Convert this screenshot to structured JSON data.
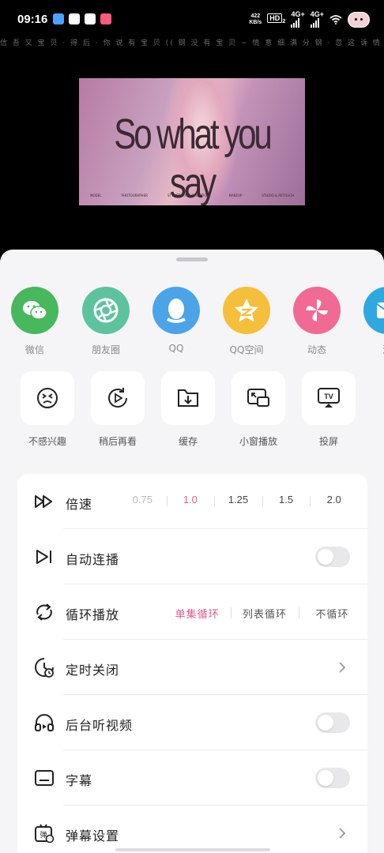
{
  "status_bar": {
    "time": "09:16",
    "net_speed_value": "422",
    "net_speed_unit": "KB/s",
    "hd_badge": "HD",
    "hd_sub": "2",
    "sim1": "4G+",
    "sim2": "4G+"
  },
  "danmaku": {
    "text": "信 吾 又 宝 贝 · 得 后 · 你 说 有 宝 贝 (( 钢 没 有 宝 贝 ~ 情 意 细 满 分 钢 · 忽 这 诉 情 意 福 · 再 是 哥 哥 · 信 吾 又 宝 贝 (( 钢"
  },
  "video": {
    "title": "So what you say",
    "credits": [
      "MODEL",
      "PHOTOGRAPHER",
      "STYLIST & ART DIRECTION",
      "MAKEUP",
      "STUDIO & RETOUCH"
    ]
  },
  "share_targets": [
    {
      "label": "微信",
      "icon": "wechat-icon",
      "color": "#47b85b"
    },
    {
      "label": "朋友圈",
      "icon": "moments-icon",
      "color": "#5cc39e"
    },
    {
      "label": "QQ",
      "icon": "qq-icon",
      "color": "#4ca4e8"
    },
    {
      "label": "QQ空间",
      "icon": "qzone-icon",
      "color": "#f5bf3b"
    },
    {
      "label": "动态",
      "icon": "pinwheel-icon",
      "color": "#f06a93"
    },
    {
      "label": "消",
      "icon": "message-icon",
      "color": "#2fa8e0"
    }
  ],
  "actions": [
    {
      "label": "不感兴趣",
      "icon": "dislike-face-icon"
    },
    {
      "label": "稍后再看",
      "icon": "watch-later-icon"
    },
    {
      "label": "缓存",
      "icon": "download-folder-icon"
    },
    {
      "label": "小窗播放",
      "icon": "picture-in-picture-icon"
    },
    {
      "label": "投屏",
      "icon": "cast-tv-icon"
    }
  ],
  "settings": {
    "speed_label": "倍速",
    "speed_options": [
      "0.75",
      "1.0",
      "1.25",
      "1.5",
      "2.0"
    ],
    "speed_selected": "1.0",
    "autoplay_label": "自动连播",
    "autoplay_on": false,
    "loop_label": "循环播放",
    "loop_options": [
      "单集循环",
      "列表循环",
      "不循环"
    ],
    "loop_selected": "单集循环",
    "timer_label": "定时关闭",
    "background_label": "后台听视频",
    "background_on": false,
    "subtitle_label": "字幕",
    "subtitle_on": false,
    "danmaku_label": "弹幕设置"
  },
  "colors": {
    "accent": "#e3578a",
    "sheet_bg": "#f5f5f7"
  }
}
